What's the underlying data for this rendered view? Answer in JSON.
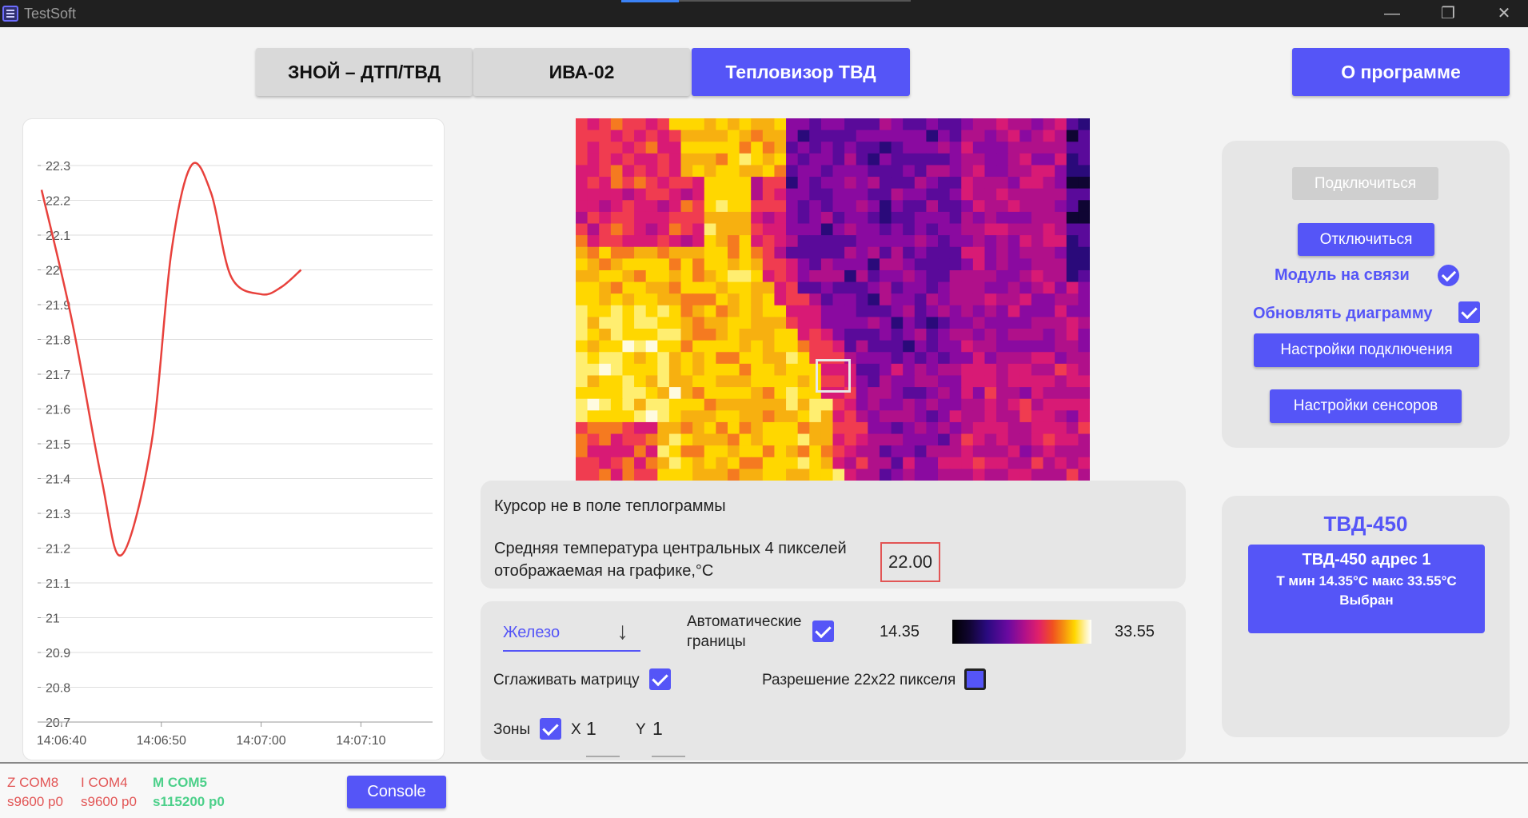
{
  "window": {
    "title": "TestSoft",
    "minimize": "—",
    "maximize": "❐",
    "close": "✕"
  },
  "tabs": [
    {
      "label": "ЗНОЙ – ДТП/ТВД",
      "active": false
    },
    {
      "label": "ИВА-02",
      "active": false
    },
    {
      "label": "Тепловизор ТВД",
      "active": true
    }
  ],
  "about_button": "О программе",
  "chart_data": {
    "type": "line",
    "title": "",
    "xlabel": "",
    "ylabel": "",
    "x_ticks": [
      "14:06:40",
      "14:06:50",
      "14:07:00",
      "14:07:10"
    ],
    "y_ticks": [
      "20.7",
      "20.8",
      "20.9",
      "21",
      "21.1",
      "21.2",
      "21.3",
      "21.4",
      "21.5",
      "21.6",
      "21.7",
      "21.8",
      "21.9",
      "22",
      "22.1",
      "22.2",
      "22.3"
    ],
    "ylim": [
      20.7,
      22.3
    ],
    "x_seconds_from": "14:06:38",
    "series": [
      {
        "color": "#e8413c",
        "x": [
          "14:06:38",
          "14:06:41",
          "14:06:44",
          "14:06:46",
          "14:06:49",
          "14:06:51",
          "14:06:53",
          "14:06:55",
          "14:06:57",
          "14:07:00",
          "14:07:02",
          "14:07:04"
        ],
        "values": [
          22.23,
          21.86,
          21.4,
          21.18,
          21.5,
          22.05,
          22.3,
          22.22,
          21.98,
          21.93,
          21.95,
          22.0
        ]
      }
    ]
  },
  "thermo": {
    "palette_colors": [
      "#0f0533",
      "#2a0a7a",
      "#5a0a9a",
      "#8a0aa0",
      "#b0108a",
      "#d81a75",
      "#f03c50",
      "#f57a20",
      "#f7b010",
      "#ffd700",
      "#ffee70",
      "#fffbe0"
    ]
  },
  "info": {
    "cursor_message": "Курсор не в поле теплограммы",
    "avg_label": "Средняя температура центральных 4 пикселей отображаемая на графике,°C",
    "avg_value": "22.00"
  },
  "controls": {
    "palette": "Железо",
    "auto_bounds_label": "Автоматические границы",
    "auto_bounds_checked": true,
    "t_min": "14.35",
    "t_max": "33.55",
    "smooth_label": "Сглаживать матрицу",
    "smooth_checked": true,
    "resolution_label": "Разрешение 22x22 пикселя",
    "resolution_checked": false,
    "zones_label": "Зоны",
    "zones_checked": true,
    "x_label": "X",
    "x_value": "1",
    "y_label": "Y",
    "y_value": "1"
  },
  "connection": {
    "connect_button": "Подключиться",
    "disconnect_button": "Отключиться",
    "module_status": "Модуль на связи",
    "update_chart_label": "Обновлять диаграмму",
    "update_chart_checked": true,
    "connection_settings_button": "Настройки подключения",
    "sensor_settings_button": "Настройки сенсоров"
  },
  "device": {
    "title": "ТВД-450",
    "card_name": "ТВД-450 адрес 1",
    "card_range": "Т мин 14.35°C макс 33.55°C",
    "card_state": "Выбран"
  },
  "status": {
    "z_port": "Z COM8",
    "z_baud": "s9600 p0",
    "i_port": "I COM4",
    "i_baud": "s9600 p0",
    "m_port": "M COM5",
    "m_baud": "s115200 p0",
    "console_button": "Console"
  }
}
